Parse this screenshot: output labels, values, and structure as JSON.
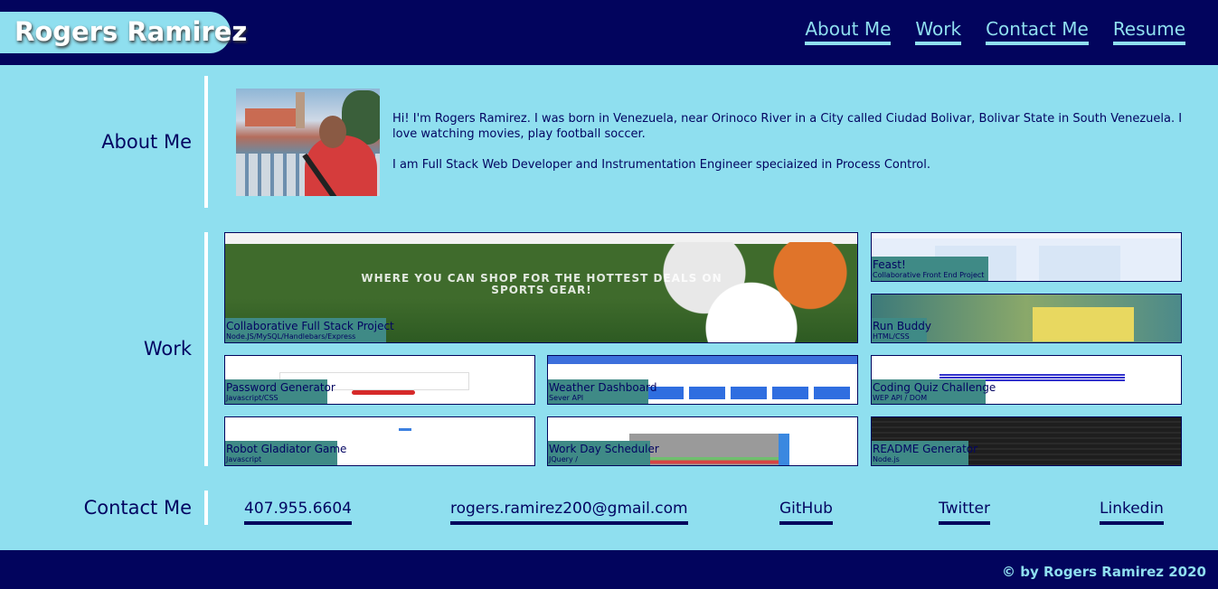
{
  "header": {
    "brand": "Rogers Ramirez",
    "nav": [
      "About Me",
      "Work",
      "Contact Me",
      "Resume"
    ]
  },
  "about": {
    "heading": "About Me",
    "paragraphs": [
      "Hi! I'm Rogers Ramirez. I was born in Venezuela, near Orinoco River in a City called Ciudad Bolivar, Bolivar State in South Venezuela. I love watching movies, play football soccer.",
      "I am Full Stack Web Developer and Instrumentation Engineer speciaized in Process Control."
    ]
  },
  "work": {
    "heading": "Work",
    "projects": [
      {
        "title": "Collaborative Full Stack Project",
        "subtitle": "Node.JS/MySQL/Handlebars/Express",
        "hero_text": "WHERE YOU CAN SHOP FOR THE HOTTEST DEALS ON SPORTS GEAR!"
      },
      {
        "title": "Feast!",
        "subtitle": "Collaborative Front End Project"
      },
      {
        "title": "Run Buddy",
        "subtitle": "HTML/CSS"
      },
      {
        "title": "Password Generator",
        "subtitle": "Javascript/CSS"
      },
      {
        "title": "Weather Dashboard",
        "subtitle": "Sever API"
      },
      {
        "title": "Coding Quiz Challenge",
        "subtitle": "WEP API / DOM"
      },
      {
        "title": "Robot Gladiator Game",
        "subtitle": "Javascript"
      },
      {
        "title": "Work Day Scheduler",
        "subtitle": "JQuery /"
      },
      {
        "title": "README Generator",
        "subtitle": "Node.js"
      }
    ]
  },
  "contact": {
    "heading": "Contact Me",
    "phone": "407.955.6604",
    "email": "rogers.ramirez200@gmail.com",
    "links": [
      "GitHub",
      "Twitter",
      "Linkedin"
    ]
  },
  "footer": {
    "text": "© by Rogers Ramirez 2020"
  }
}
